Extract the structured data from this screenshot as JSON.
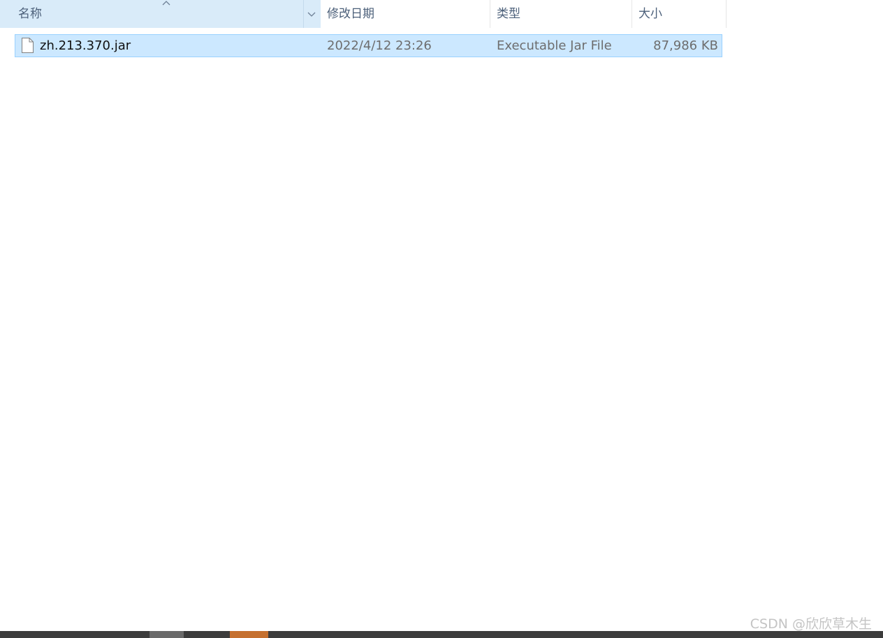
{
  "columns": {
    "name": "名称",
    "date": "修改日期",
    "type": "类型",
    "size": "大小"
  },
  "files": [
    {
      "name": "zh.213.370.jar",
      "modified": "2022/4/12 23:26",
      "type": "Executable Jar File",
      "size": "87,986 KB",
      "selected": true,
      "icon": "blank-file-icon"
    }
  ],
  "sort": {
    "column": "name",
    "direction": "ascending",
    "icon": "sort-ascending-icon"
  },
  "watermark": "CSDN @欣欣草木生",
  "colors": {
    "header_active_bg": "#d9ebf9",
    "selection_bg": "#cce8ff",
    "selection_border": "#99d1ff",
    "header_text": "#4c607a",
    "taskbar": "#3c3c3c",
    "taskbar_active": "#c5702f"
  }
}
